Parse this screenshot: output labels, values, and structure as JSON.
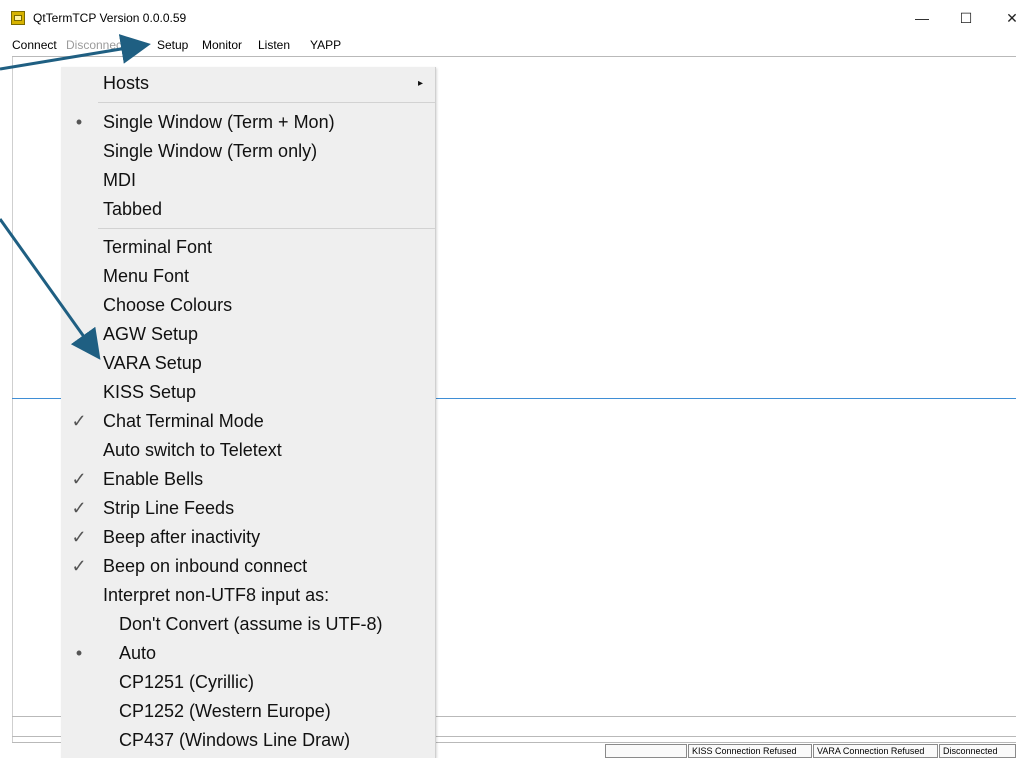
{
  "window": {
    "title": "QtTermTCP Version 0.0.0.59",
    "controls": {
      "minimize": "—",
      "maximize": "☐",
      "close": "✕"
    }
  },
  "menubar": {
    "items": [
      {
        "label": "Connect",
        "disabled": false
      },
      {
        "label": "Disconnect",
        "disabled": true
      },
      {
        "label": "Setup",
        "disabled": false
      },
      {
        "label": "Monitor",
        "disabled": false
      },
      {
        "label": "Listen",
        "disabled": false
      },
      {
        "label": "YAPP",
        "disabled": false
      }
    ]
  },
  "setup_menu": {
    "rows": [
      {
        "label": "Hosts",
        "mark": "",
        "submenu": "▸"
      },
      {
        "label": "Single Window (Term + Mon)",
        "mark": "•"
      },
      {
        "label": "Single Window (Term only)",
        "mark": ""
      },
      {
        "label": "MDI",
        "mark": ""
      },
      {
        "label": "Tabbed",
        "mark": ""
      },
      {
        "label": "Terminal Font",
        "mark": ""
      },
      {
        "label": "Menu Font",
        "mark": ""
      },
      {
        "label": "Choose Colours",
        "mark": ""
      },
      {
        "label": "AGW Setup",
        "mark": ""
      },
      {
        "label": "VARA Setup",
        "mark": ""
      },
      {
        "label": "KISS Setup",
        "mark": ""
      },
      {
        "label": "Chat Terminal Mode",
        "mark": "✓"
      },
      {
        "label": "Auto switch to Teletext",
        "mark": ""
      },
      {
        "label": "Enable Bells",
        "mark": "✓"
      },
      {
        "label": "Strip Line Feeds",
        "mark": "✓"
      },
      {
        "label": "Beep after inactivity",
        "mark": "✓"
      },
      {
        "label": "Beep on inbound connect",
        "mark": "✓"
      },
      {
        "label": "Interpret non-UTF8 input as:",
        "mark": ""
      },
      {
        "label": "Don't Convert (assume is UTF-8)",
        "mark": ""
      },
      {
        "label": "Auto",
        "mark": "•"
      },
      {
        "label": "CP1251 (Cyrillic)",
        "mark": ""
      },
      {
        "label": "CP1252 (Western Europe)",
        "mark": ""
      },
      {
        "label": "CP437 (Windows Line Draw)",
        "mark": ""
      }
    ]
  },
  "statusbar": {
    "fields": [
      "",
      "KISS Connection Refused",
      "VARA Connection Refused",
      "Disconnected"
    ]
  },
  "colors": {
    "annotation_arrow": "#1f5f82",
    "split_line": "#3f8ed5",
    "menu_background": "#efefef"
  }
}
